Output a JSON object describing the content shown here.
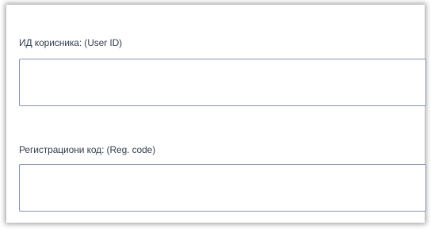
{
  "form": {
    "user_id_label": "ИД корисника: (User ID)",
    "user_id_value": "",
    "reg_code_label": "Регистрациони код: (Reg. code)",
    "reg_code_value": ""
  }
}
